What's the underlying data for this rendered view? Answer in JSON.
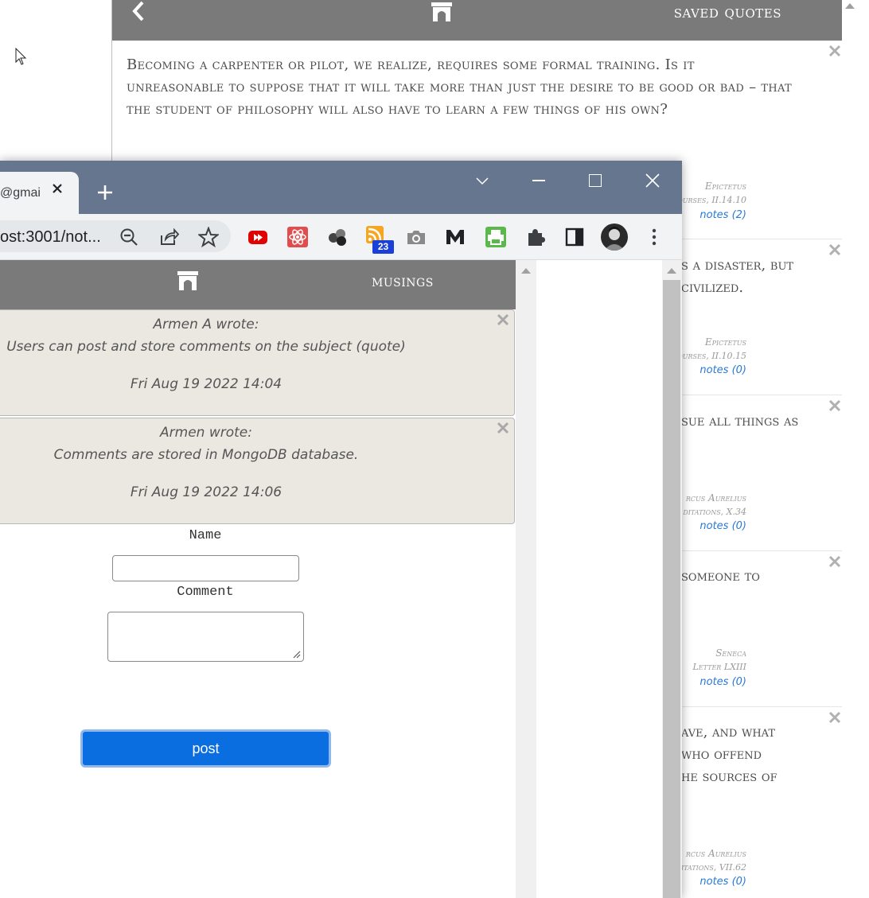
{
  "background_app": {
    "header_title": "saved quotes",
    "icons": {
      "back": "chevron-left-icon",
      "home": "arch-icon",
      "cursor": "mouse-pointer-icon"
    },
    "quotes": [
      {
        "text": "Becoming a carpenter or pilot, we realize, requires some formal training. Is it unreasonable to suppose that it will take more than just the desire to be good or bad – that the student of philosophy will also have to learn a few things of his own?",
        "author": "Epictetus",
        "source": "ourses, II.14.10",
        "notes": "notes (2)"
      },
      {
        "text_lines": [
          "s a disaster, but",
          "civilized."
        ],
        "author": "Epictetus",
        "source": "ourses, II.10.15",
        "notes": "notes (0)"
      },
      {
        "text_lines": [
          "sue all things as"
        ],
        "author": "rcus Aurelius",
        "source": "ditations, X.34",
        "notes": "notes (0)"
      },
      {
        "text_lines": [
          "someone to"
        ],
        "author": "Seneca",
        "source": "Letter LXIII",
        "notes": "notes (0)"
      },
      {
        "text_lines": [
          "ave, and what",
          "who offend",
          "he sources of"
        ],
        "author": "rcus Aurelius",
        "source": "itations, VII.62",
        "notes": "notes (0)"
      }
    ]
  },
  "browser": {
    "tab_title": "@gmai",
    "url": "ost:3001/not...",
    "toolbar_icons": [
      "zoom-out-icon",
      "share-icon",
      "star-icon",
      "youtube-icon",
      "atom-icon",
      "spheres-icon",
      "rss-icon",
      "camera-icon",
      "m-logo-icon",
      "printer-icon",
      "puzzle-icon",
      "side-panel-icon",
      "avatar",
      "more-vertical-icon"
    ],
    "extension_badge": "23",
    "window_controls": [
      "chevron-down-icon",
      "minimize-icon",
      "maximize-icon",
      "close-icon"
    ]
  },
  "page": {
    "header_title": "musings",
    "comments": [
      {
        "author": "Armen A wrote:",
        "body": "Users can post and store comments on the subject (quote)",
        "date": "Fri Aug 19 2022 14:04"
      },
      {
        "author": "Armen wrote:",
        "body": "Comments are stored in MongoDB database.",
        "date": "Fri Aug 19 2022 14:06"
      }
    ],
    "form": {
      "name_label": "Name",
      "name_value": "",
      "comment_label": "Comment",
      "comment_value": "",
      "submit_label": "post"
    }
  },
  "colors": {
    "header_gray": "#7a7a7a",
    "titlebar": "#66768e",
    "comment_bg": "#ebe8e2",
    "button_blue": "#0a6de0",
    "notes_link": "#2a7ad6"
  }
}
